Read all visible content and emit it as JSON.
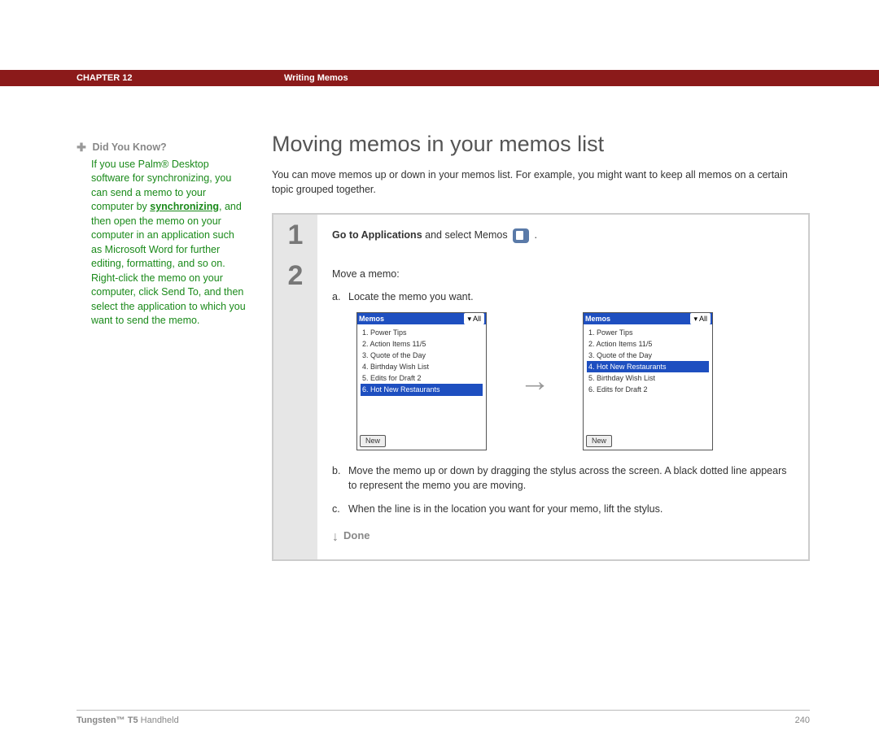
{
  "header": {
    "chapter_label": "CHAPTER 12",
    "chapter_title": "Writing Memos"
  },
  "sidebar": {
    "dyk_title": "Did You Know?",
    "dyk_before_link": "If you use Palm® Desktop software for synchronizing, you can send a memo to your computer by ",
    "dyk_link": "synchronizing",
    "dyk_after_link": ", and then open the memo on your computer in an application such as Microsoft Word for further editing, formatting, and so on. Right-click the memo on your computer, click Send To, and then select the application to which you want to send the memo."
  },
  "main": {
    "title": "Moving memos in your memos list",
    "intro": "You can move memos up or down in your memos list. For example, you might want to keep all memos on a certain topic grouped together.",
    "step1": {
      "bold": "Go to Applications",
      "rest": " and select Memos ",
      "tail": " ."
    },
    "step2": {
      "lead": "Move a memo:",
      "a": "Locate the memo you want.",
      "b": "Move the memo up or down by dragging the stylus across the screen. A black dotted line appears to represent the memo you are moving.",
      "c": "When the line is in the location you want for your memo, lift the stylus.",
      "done": "Done"
    },
    "memos_app": {
      "title": "Memos",
      "category": "▾ All",
      "new_label": "New",
      "before": [
        "1. Power Tips",
        "2. Action Items 11/5",
        "3. Quote of the Day",
        "4. Birthday Wish List",
        "5. Edits for Draft 2",
        "6. Hot New Restaurants"
      ],
      "before_selected_index": 5,
      "after": [
        "1. Power Tips",
        "2. Action Items 11/5",
        "3. Quote of the Day",
        "4. Hot New Restaurants",
        "5. Birthday Wish List",
        "6. Edits for Draft 2"
      ],
      "after_selected_index": 3
    }
  },
  "footer": {
    "product_bold": "Tungsten™ T5",
    "product_rest": " Handheld",
    "page": "240"
  }
}
